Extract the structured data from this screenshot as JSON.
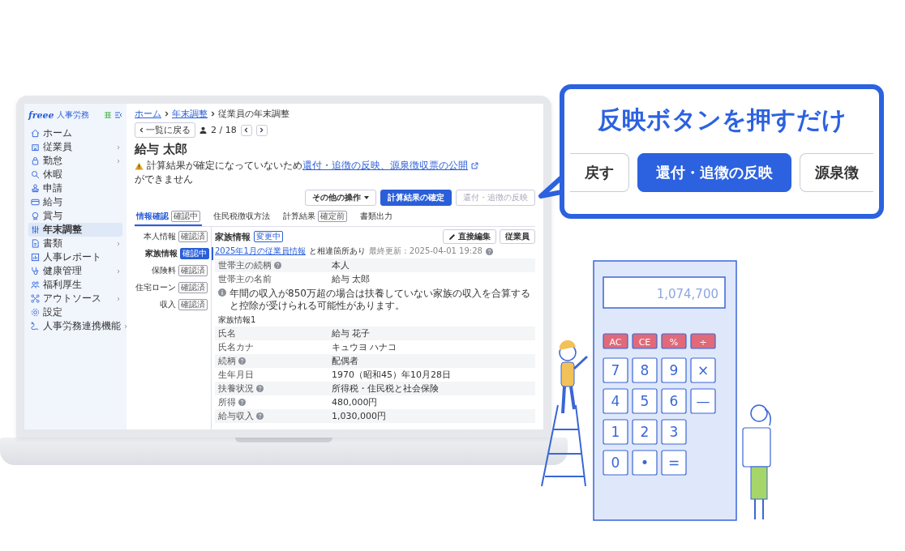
{
  "sidebar": {
    "logo": "freee",
    "product": "人事労務",
    "items": [
      {
        "label": "ホーム",
        "expandable": false,
        "selected": false
      },
      {
        "label": "従業員",
        "expandable": true,
        "selected": false
      },
      {
        "label": "勤怠",
        "expandable": true,
        "selected": false
      },
      {
        "label": "休暇",
        "expandable": false,
        "selected": false
      },
      {
        "label": "申請",
        "expandable": false,
        "selected": false
      },
      {
        "label": "給与",
        "expandable": false,
        "selected": false
      },
      {
        "label": "賞与",
        "expandable": false,
        "selected": false
      },
      {
        "label": "年末調整",
        "expandable": false,
        "selected": true
      },
      {
        "label": "書類",
        "expandable": true,
        "selected": false
      },
      {
        "label": "人事レポート",
        "expandable": false,
        "selected": false
      },
      {
        "label": "健康管理",
        "expandable": true,
        "selected": false
      },
      {
        "label": "福利厚生",
        "expandable": false,
        "selected": false
      },
      {
        "label": "アウトソース",
        "expandable": true,
        "selected": false
      },
      {
        "label": "設定",
        "expandable": false,
        "selected": false
      },
      {
        "label": "人事労務連携機能",
        "expandable": true,
        "selected": false
      }
    ]
  },
  "breadcrumb": [
    {
      "label": "ホーム",
      "link": true
    },
    {
      "label": "年末調整",
      "link": true
    },
    {
      "label": "従業員の年末調整",
      "link": false
    }
  ],
  "pager": {
    "back": "一覧に戻る",
    "position": "2 / 18"
  },
  "employee_name": "給与 太郎",
  "warning": {
    "before": "計算結果が確定になっていないため",
    "link": "還付・追徴の反映、源泉徴収票の公開",
    "after": "ができません"
  },
  "actions": [
    {
      "label": "その他の操作",
      "kind": "menu",
      "disabled": false
    },
    {
      "label": "計算結果の確定",
      "kind": "primary",
      "disabled": false
    },
    {
      "label": "還付・追徴の反映",
      "kind": "plain",
      "disabled": true
    }
  ],
  "tabs": [
    {
      "label": "情報確認",
      "badge": "確認中",
      "selected": true
    },
    {
      "label": "住民税徴収方法",
      "selected": false
    },
    {
      "label": "計算結果",
      "badge": "確定前",
      "selected": false
    },
    {
      "label": "書類出力",
      "selected": false
    }
  ],
  "subnav": [
    {
      "label": "本人情報",
      "badge": "確認済",
      "selected": false
    },
    {
      "label": "家族情報",
      "badge": "確認中",
      "selected": true
    },
    {
      "label": "保険料",
      "badge": "確認済",
      "selected": false
    },
    {
      "label": "住宅ローン",
      "badge": "確認済",
      "selected": false
    },
    {
      "label": "収入",
      "badge": "確認済",
      "selected": false
    }
  ],
  "section": {
    "title": "家族情報",
    "badge": "変更中",
    "link": "2025年1月の従業員情報",
    "note": "と相違箇所あり",
    "updated": "最終更新：2025-04-01 19:28",
    "buttons": [
      {
        "label": "直接編集",
        "kind": "edit"
      },
      {
        "label": "従業員",
        "kind": "plain"
      }
    ],
    "rows": [
      {
        "kind": "field",
        "label": "世帯主の続柄",
        "help": true,
        "value": "本人"
      },
      {
        "kind": "field",
        "label": "世帯主の名前",
        "help": false,
        "value": "給与 太郎"
      },
      {
        "kind": "info",
        "text": "年間の収入が850万超の場合は扶養していない家族の収入を合算すると控除が受けられる可能性があります。"
      },
      {
        "kind": "heading",
        "text": "家族情報1"
      },
      {
        "kind": "field",
        "label": "氏名",
        "help": false,
        "value": "給与 花子"
      },
      {
        "kind": "field",
        "label": "氏名カナ",
        "help": false,
        "value": "キュウヨ ハナコ"
      },
      {
        "kind": "field",
        "label": "続柄",
        "help": true,
        "value": "配偶者"
      },
      {
        "kind": "field",
        "label": "生年月日",
        "help": false,
        "value": "1970（昭和45）年10月28日"
      },
      {
        "kind": "field",
        "label": "扶養状況",
        "help": true,
        "value": "所得税・住民税と社会保険"
      },
      {
        "kind": "field",
        "label": "所得",
        "help": true,
        "value": "480,000円"
      },
      {
        "kind": "field",
        "label": "給与収入",
        "help": true,
        "value": "1,030,000円"
      }
    ]
  },
  "callout": {
    "title": "反映ボタンを押すだけ",
    "buttons": [
      {
        "label": "戻す",
        "kind": "plain"
      },
      {
        "label": "還付・追徴の反映",
        "kind": "primary"
      },
      {
        "label": "源泉徴",
        "kind": "plain"
      }
    ]
  },
  "calculator": {
    "display": "1,074,700",
    "keys": [
      [
        {
          "label": "AC",
          "kind": "function"
        },
        {
          "label": "CE",
          "kind": "function"
        },
        {
          "label": "%",
          "kind": "function"
        },
        {
          "label": "÷",
          "kind": "function"
        }
      ],
      [
        {
          "label": "7",
          "kind": "number"
        },
        {
          "label": "8",
          "kind": "number"
        },
        {
          "label": "9",
          "kind": "number"
        },
        {
          "label": "×",
          "kind": "number"
        }
      ],
      [
        {
          "label": "4",
          "kind": "number"
        },
        {
          "label": "5",
          "kind": "number"
        },
        {
          "label": "6",
          "kind": "number"
        },
        {
          "label": "—",
          "kind": "number"
        }
      ],
      [
        {
          "label": "1",
          "kind": "number"
        },
        {
          "label": "2",
          "kind": "number"
        },
        {
          "label": "3",
          "kind": "number"
        }
      ],
      [
        {
          "label": "0",
          "kind": "number"
        },
        {
          "label": "•",
          "kind": "number"
        },
        {
          "label": "=",
          "kind": "number"
        }
      ]
    ]
  }
}
